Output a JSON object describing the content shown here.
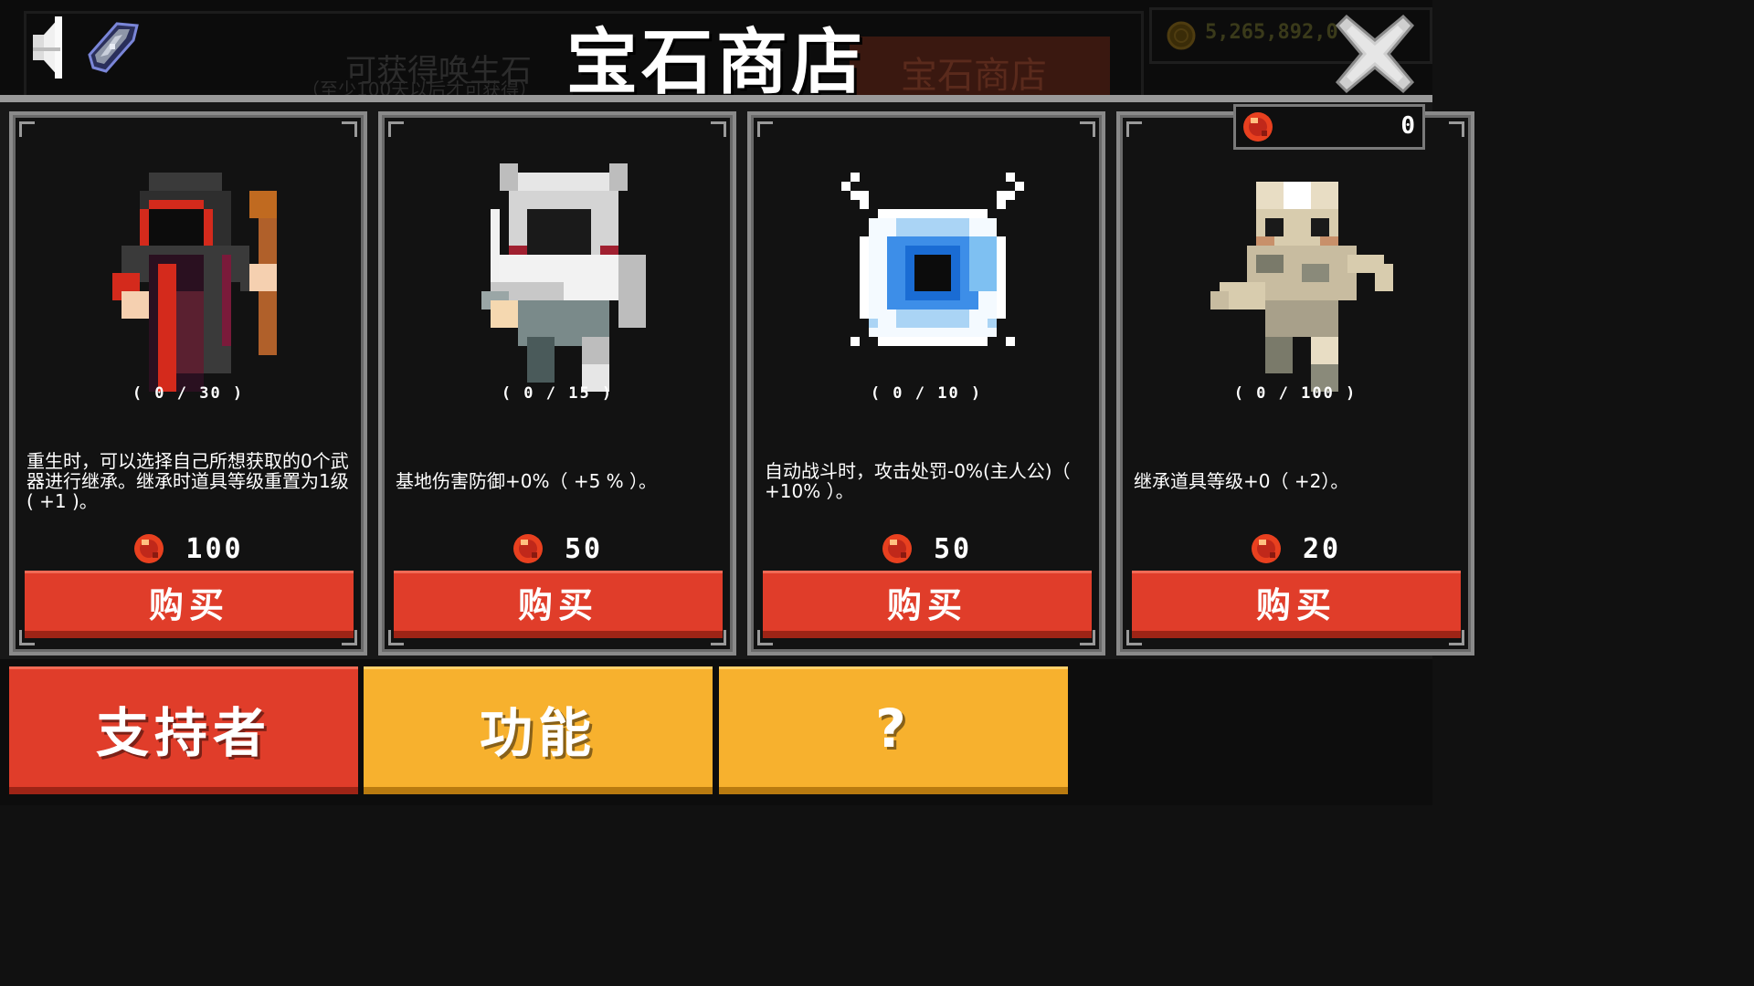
{
  "header": {
    "title": "宝石商店",
    "bg_hint_line1": "可获得唤生石",
    "bg_hint_line2": "（至少100天以后才可获得）",
    "bg_shop_label": "宝石商店",
    "coin_amount": "5,265,892,0"
  },
  "gem_balance": "0",
  "cards": [
    {
      "sprite": "dark-mage-icon",
      "progress": "( 0 / 30 )",
      "description": "重生时，可以选择自己所想获取的0个武器进行继承。继承时道具等级重置为1级( +1 )。",
      "price": "100",
      "buy_label": "购买"
    },
    {
      "sprite": "knight-armor-icon",
      "progress": "( 0 / 15 )",
      "description": "基地伤害防御+0%（ +5 % ）。",
      "price": "50",
      "buy_label": "购买"
    },
    {
      "sprite": "blue-eye-orb-icon",
      "progress": "( 0 / 10 )",
      "description": "自动战斗时，攻击处罚-0%(主人公)（ +10% ）。",
      "price": "50",
      "buy_label": "购买"
    },
    {
      "sprite": "mummy-icon",
      "progress": "( 0 / 100 )",
      "description": "继承道具等级+0（ +2）。",
      "price": "20",
      "buy_label": "购买"
    }
  ],
  "tabs": [
    {
      "label": "支持者"
    },
    {
      "label": "功能"
    },
    {
      "label": "?"
    }
  ],
  "colors": {
    "buy_red": "#e03d2a",
    "tab_yellow": "#f7b12e",
    "panel_bg": "#121212",
    "gem_red": "#e8401f"
  }
}
